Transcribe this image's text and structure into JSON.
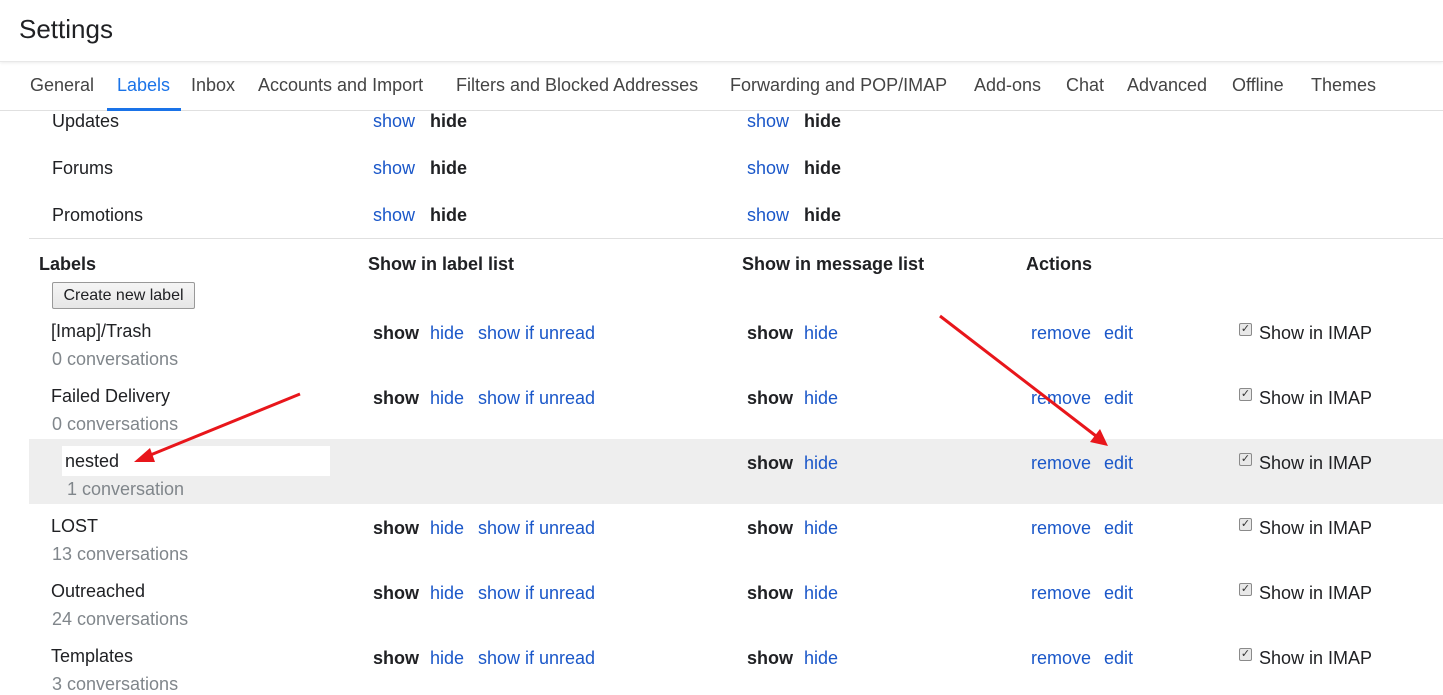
{
  "header": {
    "title": "Settings"
  },
  "tabs": [
    "General",
    "Labels",
    "Inbox",
    "Accounts and Import",
    "Filters and Blocked Addresses",
    "Forwarding and POP/IMAP",
    "Add-ons",
    "Chat",
    "Advanced",
    "Offline",
    "Themes"
  ],
  "active_tab": "Labels",
  "categories": [
    {
      "name": "Updates",
      "show": "show",
      "hide": "hide"
    },
    {
      "name": "Forums",
      "show": "show",
      "hide": "hide"
    },
    {
      "name": "Promotions",
      "show": "show",
      "hide": "hide"
    }
  ],
  "labels_section": {
    "col_labels": "Labels",
    "col_label_list": "Show in label list",
    "col_message_list": "Show in message list",
    "col_actions": "Actions",
    "create_button": "Create new label"
  },
  "link_text": {
    "show": "show",
    "hide": "hide",
    "show_if_unread": "show if unread",
    "remove": "remove",
    "edit": "edit",
    "show_in_imap": "Show in IMAP"
  },
  "labels": [
    {
      "name": "[Imap]/Trash",
      "count": "0 conversations"
    },
    {
      "name": "Failed Delivery",
      "count": "0 conversations"
    },
    {
      "name": "nested",
      "count": "1 conversation"
    },
    {
      "name": "LOST",
      "count": "13 conversations"
    },
    {
      "name": "Outreached",
      "count": "24 conversations"
    },
    {
      "name": "Templates",
      "count": "3 conversations"
    }
  ],
  "colors": {
    "link": "#1a57c9",
    "accent": "#1a73e8",
    "highlight_row": "#eeeeee",
    "annotation_arrow": "#e8161b"
  }
}
